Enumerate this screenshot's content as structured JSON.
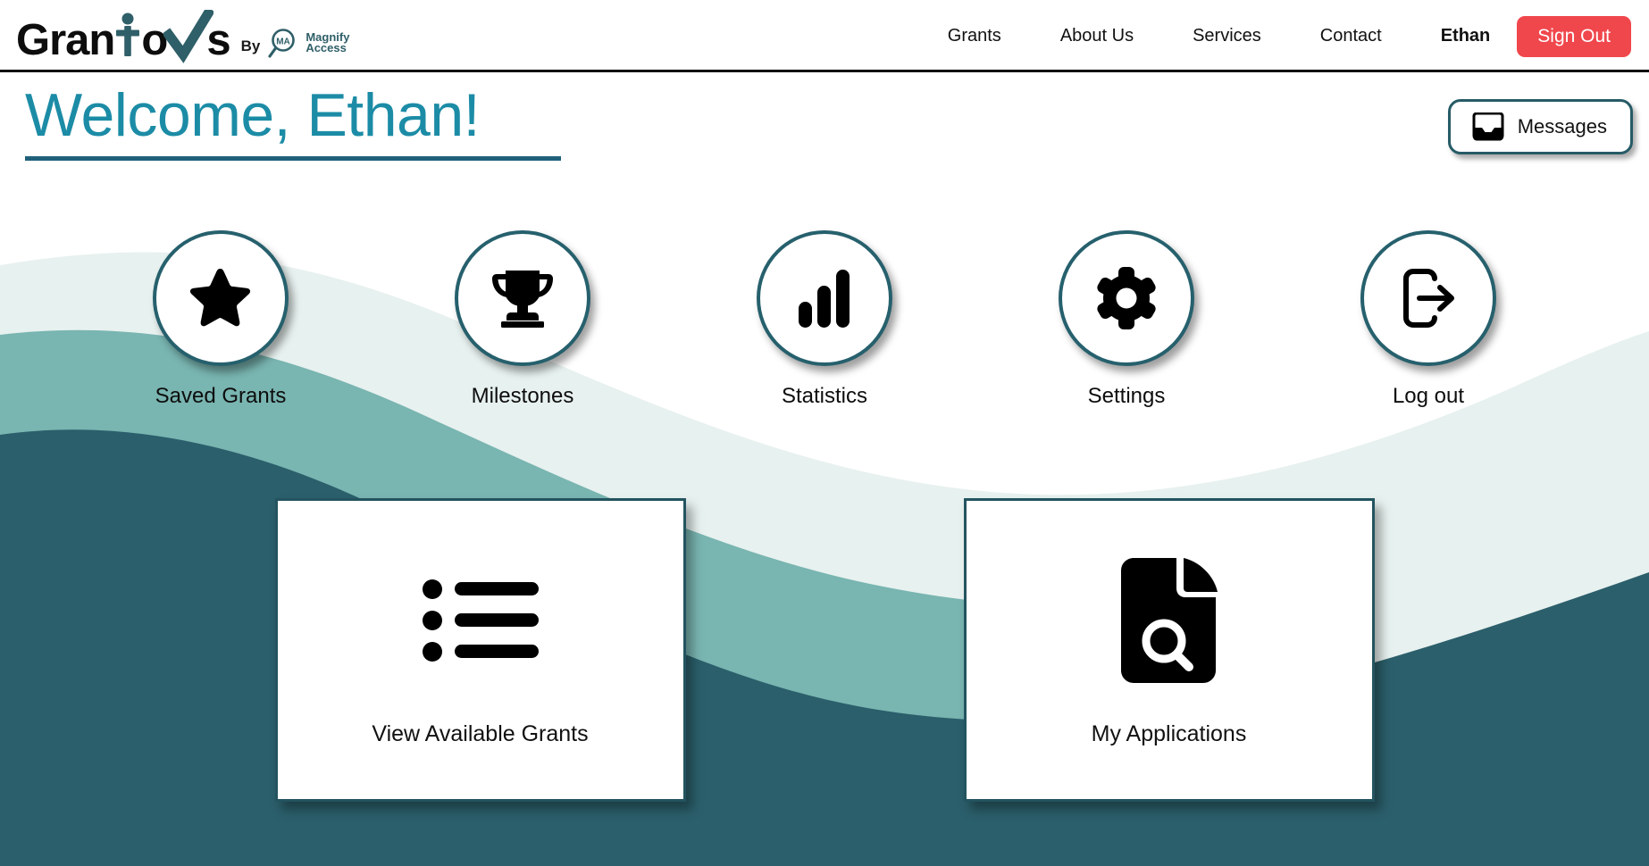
{
  "brand": {
    "name_prefix": "Gran",
    "name_mid": "o",
    "name_suffix": "s",
    "by_label": "By",
    "partner_initials": "MA",
    "partner_line1": "Magnify",
    "partner_line2": "Access"
  },
  "nav": {
    "links": [
      {
        "label": "Grants",
        "name": "nav-link-grants"
      },
      {
        "label": "About Us",
        "name": "nav-link-about-us"
      },
      {
        "label": "Services",
        "name": "nav-link-services"
      },
      {
        "label": "Contact",
        "name": "nav-link-contact"
      }
    ],
    "user": "Ethan",
    "sign_out": "Sign Out"
  },
  "header": {
    "welcome_title": "Welcome, Ethan!",
    "messages_label": "Messages",
    "messages_icon": "inbox-icon"
  },
  "quick_actions": [
    {
      "label": "Saved Grants",
      "icon": "star-icon",
      "key": "saved-grants"
    },
    {
      "label": "Milestones",
      "icon": "trophy-icon",
      "key": "milestones"
    },
    {
      "label": "Statistics",
      "icon": "bar-chart-icon",
      "key": "statistics"
    },
    {
      "label": "Settings",
      "icon": "gear-icon",
      "key": "settings"
    },
    {
      "label": "Log out",
      "icon": "logout-icon",
      "key": "log-out"
    }
  ],
  "cards": [
    {
      "label": "View Available Grants",
      "icon": "list-icon",
      "key": "view-available-grants"
    },
    {
      "label": "My Applications",
      "icon": "document-search-icon",
      "key": "my-applications"
    }
  ],
  "colors": {
    "accent_teal": "#1c8ca6",
    "brand_check": "#2f5f68",
    "danger_red": "#f0474c",
    "wave_pale": "#e7f1ef",
    "wave_mid": "#79b5b1",
    "wave_dark": "#2b5f6b",
    "border_dark": "#23545f"
  }
}
